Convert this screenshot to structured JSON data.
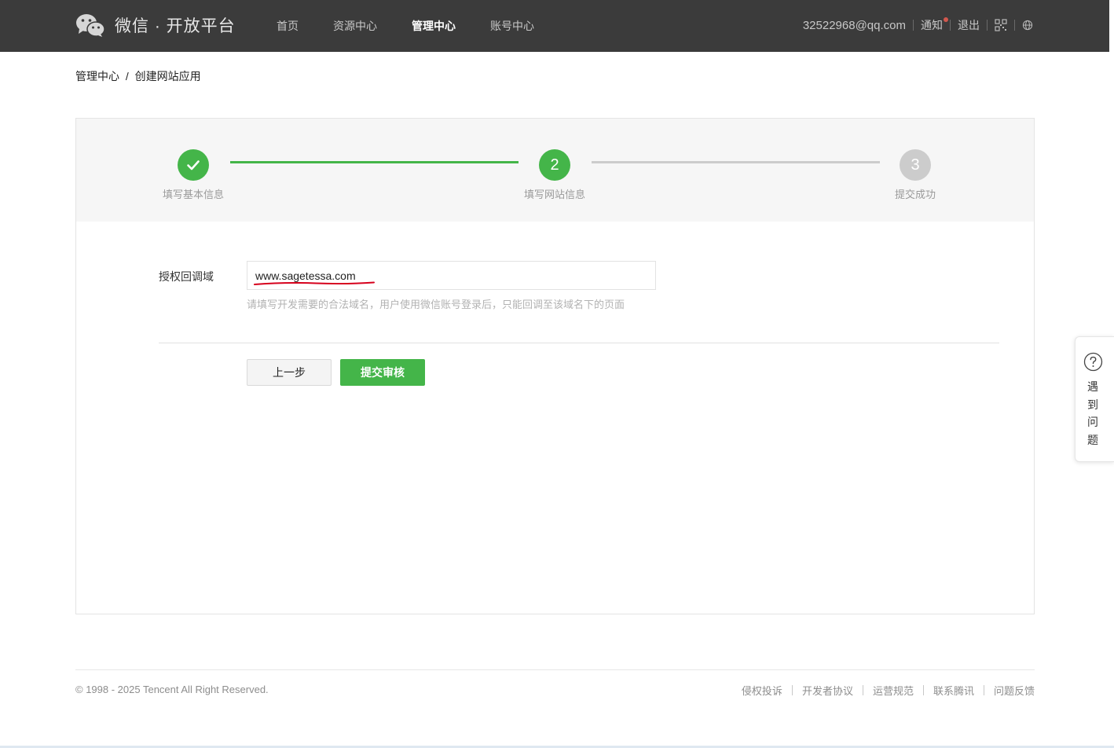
{
  "header": {
    "brand": "微信 · 开放平台",
    "nav": [
      {
        "label": "首页",
        "active": false
      },
      {
        "label": "资源中心",
        "active": false
      },
      {
        "label": "管理中心",
        "active": true
      },
      {
        "label": "账号中心",
        "active": false
      }
    ],
    "account_email": "32522968@qq.com",
    "notice_label": "通知",
    "logout_label": "退出"
  },
  "breadcrumb": {
    "parent": "管理中心",
    "separator": "/",
    "current": "创建网站应用"
  },
  "steps": [
    {
      "number": "✓",
      "label": "填写基本信息",
      "state": "done"
    },
    {
      "number": "2",
      "label": "填写网站信息",
      "state": "current"
    },
    {
      "number": "3",
      "label": "提交成功",
      "state": "todo"
    }
  ],
  "form": {
    "callback_label": "授权回调域",
    "callback_value": "www.sagetessa.com",
    "callback_hint": "请填写开发需要的合法域名，用户使用微信账号登录后，只能回调至该域名下的页面"
  },
  "buttons": {
    "prev": "上一步",
    "submit": "提交审核"
  },
  "help": {
    "label": "遇到问题"
  },
  "footer": {
    "copyright": "© 1998 - 2025 Tencent All Right Reserved.",
    "links": [
      "侵权投诉",
      "开发者协议",
      "运营规范",
      "联系腾讯",
      "问题反馈"
    ]
  },
  "colors": {
    "header_bg": "#3b3b3b",
    "accent_green": "#44b549",
    "inactive_grey": "#cccccc",
    "notice_dot": "#d2584e"
  }
}
